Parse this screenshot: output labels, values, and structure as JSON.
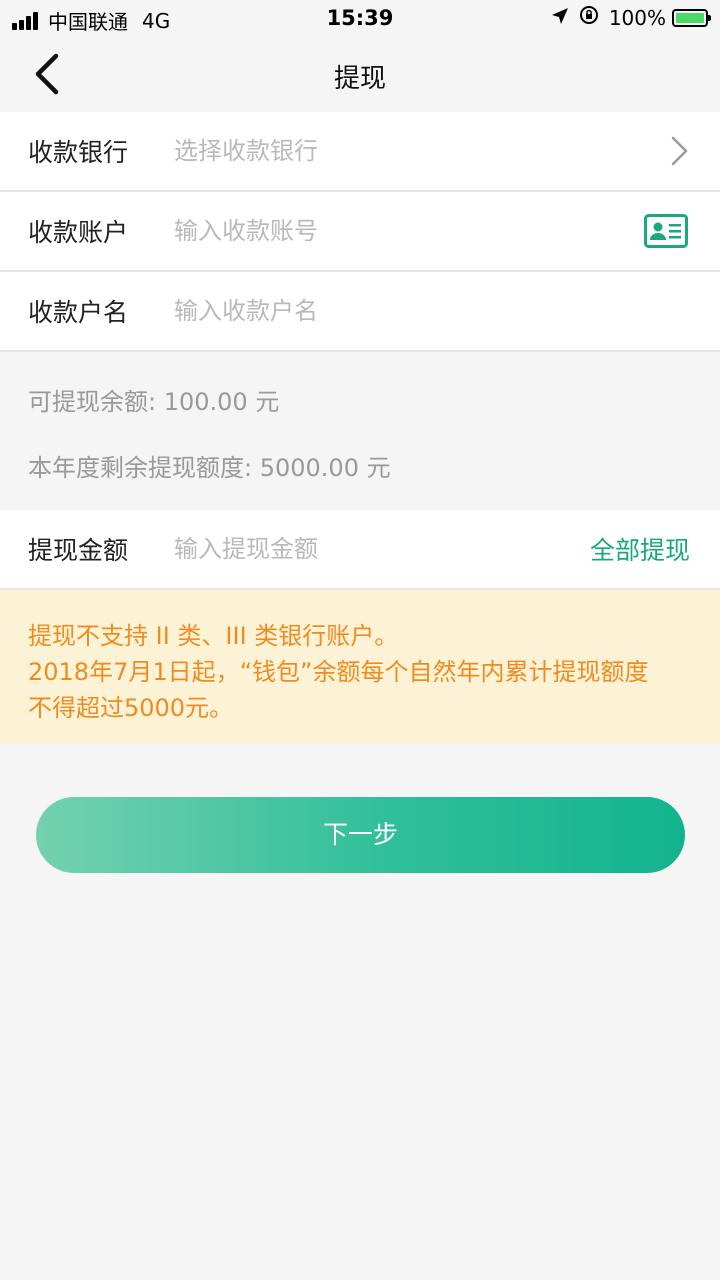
{
  "status_bar": {
    "carrier": "中国联通",
    "network": "4G",
    "time": "15:39",
    "battery": "100%"
  },
  "nav": {
    "title": "提现"
  },
  "form": {
    "bank": {
      "label": "收款银行",
      "placeholder": "选择收款银行"
    },
    "account": {
      "label": "收款账户",
      "placeholder": "输入收款账号"
    },
    "name": {
      "label": "收款户名",
      "placeholder": "输入收款户名"
    }
  },
  "info": {
    "balance": "可提现余额: 100.00 元",
    "year_limit": "本年度剩余提现额度: 5000.00 元"
  },
  "amount": {
    "label": "提现金额",
    "placeholder": "输入提现金额",
    "withdraw_all": "全部提现"
  },
  "notice": {
    "line1": "提现不支持 II 类、III 类银行账户。",
    "line2": "2018年7月1日起，“钱包”余额每个自然年内累计提现额度",
    "line3": "不得超过5000元。"
  },
  "button": {
    "next": "下一步"
  },
  "colors": {
    "accent": "#1ba87c",
    "notice_text": "#f08c1f",
    "notice_bg": "#fcf3d7"
  }
}
